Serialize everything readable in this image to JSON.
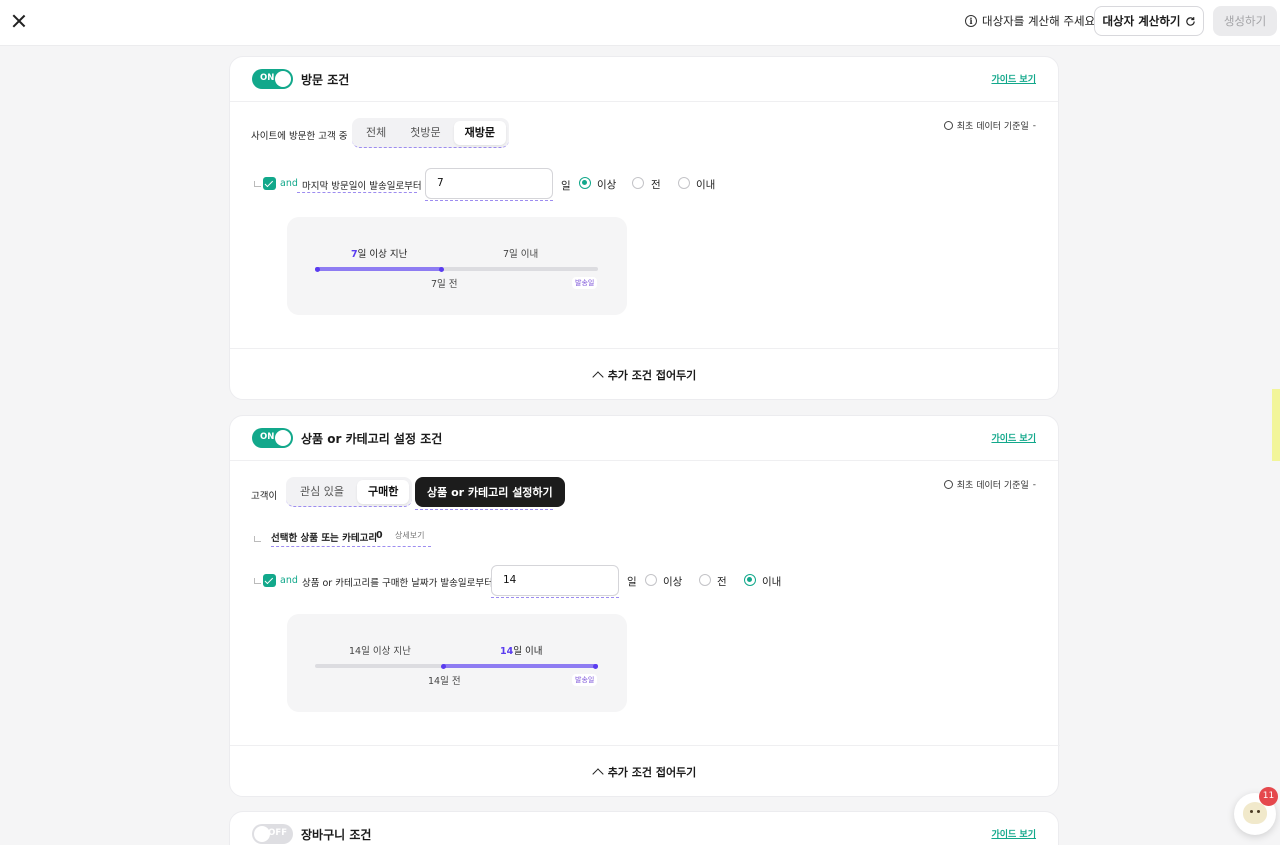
{
  "topbar": {
    "notice": "대상자를 계산해 주세요.",
    "calc_button": "대상자 계산하기",
    "create_button": "생성하기"
  },
  "cards": {
    "visit": {
      "toggle": "ON",
      "title": "방문 조건",
      "guide": "가이드 보기",
      "basis": "최초 데이터 기준일",
      "basis_value": "-",
      "row_label": "사이트에 방문한 고객 중",
      "options": [
        "전체",
        "첫방문",
        "재방문"
      ],
      "selected": "재방문",
      "and": "and",
      "condition_label": "마지막 방문일이 발송일로부터",
      "days_value": "7",
      "unit": "일",
      "radios": [
        "이상",
        "전",
        "이내"
      ],
      "radio_selected": "이상",
      "timeline": {
        "left_num": "7",
        "left_text": "일 이상 지난",
        "right_text": "7일 이내",
        "mid_label": "7일 전",
        "end_label": "발송일",
        "filled_fraction": 0.45
      },
      "fold": "추가 조건 접어두기"
    },
    "product": {
      "toggle": "ON",
      "title": "상품 or 카테고리 설정 조건",
      "guide": "가이드 보기",
      "basis": "최초 데이터 기준일",
      "basis_value": "-",
      "row_label": "고객이",
      "options": [
        "관심 있을",
        "구매한"
      ],
      "selected": "구매한",
      "set_button": "상품 or 카테고리 설정하기",
      "selected_items_label": "선택한 상품 또는 카테고리",
      "selected_items_count": "0",
      "detail_link": "상세보기",
      "and": "and",
      "condition_label": "상품 or 카테고리를 구매한 날짜가 발송일로부터",
      "days_value": "14",
      "unit": "일",
      "radios": [
        "이상",
        "전",
        "이내"
      ],
      "radio_selected": "이내",
      "timeline": {
        "left_text": "14일 이상 지난",
        "right_num": "14",
        "right_text": "일 이내",
        "mid_label": "14일 전",
        "end_label": "발송일",
        "filled_fraction": 0.55
      },
      "fold": "추가 조건 접어두기"
    },
    "cart": {
      "toggle": "OFF",
      "title": "장바구니 조건",
      "guide": "가이드 보기"
    }
  },
  "chat": {
    "badge": "11"
  },
  "colors": {
    "accent": "#12a88b",
    "purple": "#5a3cf0",
    "dark_button": "#1c1c1c"
  }
}
